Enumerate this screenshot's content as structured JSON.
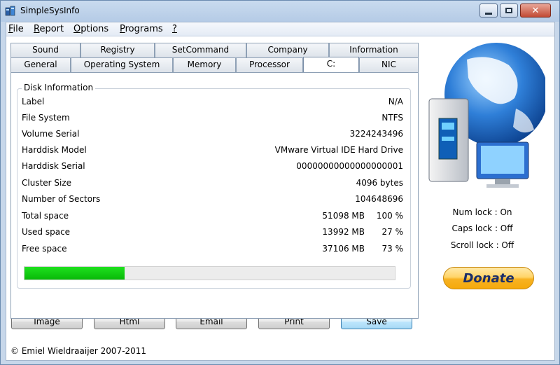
{
  "window": {
    "title": "SimpleSysInfo"
  },
  "menu": [
    {
      "label": "File",
      "u": "F",
      "rest": "ile"
    },
    {
      "label": "Report",
      "u": "R",
      "rest": "eport"
    },
    {
      "label": "Options",
      "u": "O",
      "rest": "ptions"
    },
    {
      "label": "Programs",
      "u": "P",
      "rest": "rograms"
    },
    {
      "label": "?",
      "u": "?",
      "rest": ""
    }
  ],
  "tabs_top": [
    "Sound",
    "Registry",
    "SetCommand",
    "Company",
    "Information"
  ],
  "tabs_bottom": [
    "General",
    "Operating System",
    "Memory",
    "Processor",
    "C:",
    "NIC"
  ],
  "active_tab": "C:",
  "disk": {
    "group_title": "Disk Information",
    "rows": [
      {
        "label": "Label",
        "value": "N/A"
      },
      {
        "label": "File System",
        "value": "NTFS"
      },
      {
        "label": "Volume Serial",
        "value": "3224243496"
      },
      {
        "label": "Harddisk Model",
        "value": "VMware Virtual IDE Hard Drive"
      },
      {
        "label": "Harddisk Serial",
        "value": "00000000000000000001"
      },
      {
        "label": "Cluster Size",
        "value": "4096 bytes"
      },
      {
        "label": "Number of Sectors",
        "value": "104648696"
      }
    ],
    "space": [
      {
        "label": "Total space",
        "value": "51098 MB",
        "pct": "100 %"
      },
      {
        "label": "Used space",
        "value": "13992 MB",
        "pct": "27 %"
      },
      {
        "label": "Free space",
        "value": "37106 MB",
        "pct": "73 %"
      }
    ],
    "used_fraction": 0.27
  },
  "buttons": {
    "image": "Image",
    "html": "Html",
    "email": "Email",
    "print": "Print",
    "save": "Save"
  },
  "copyright": "© Emiel Wieldraaijer 2007-2011",
  "status": {
    "num_lock": "Num lock : On",
    "caps_lock": "Caps lock : Off",
    "scroll_lock": "Scroll lock : Off"
  },
  "donate_label": "Donate",
  "icons": {
    "app": "app-icon",
    "globe": "globe-computer-icon"
  },
  "colors": {
    "progress": "#0fcf0f",
    "donate": "#f7b323"
  }
}
